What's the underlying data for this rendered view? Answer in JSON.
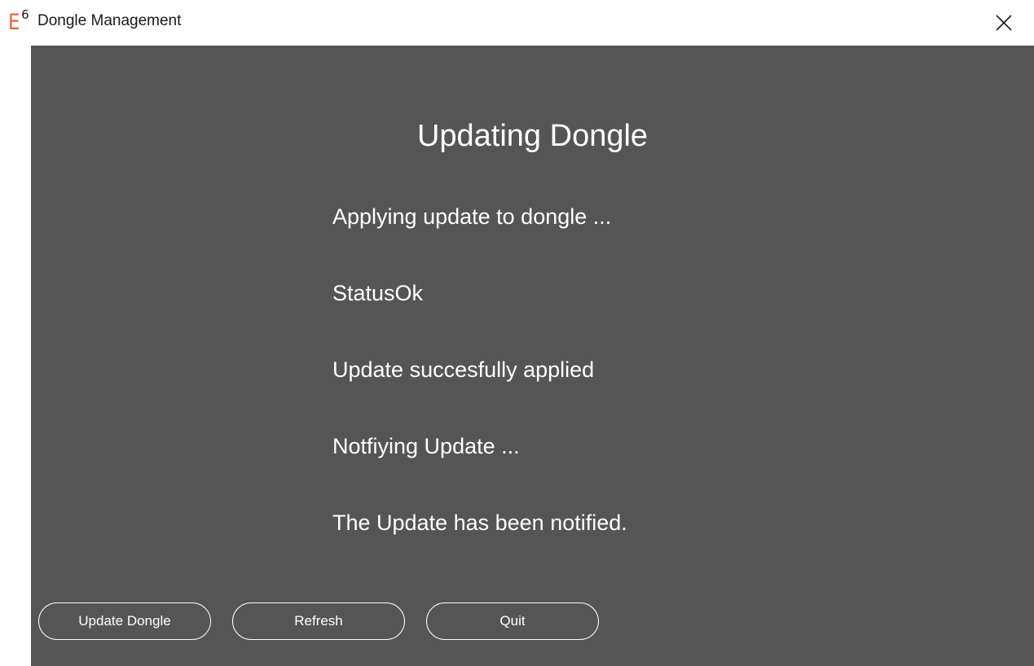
{
  "window": {
    "logo_letter": "E",
    "logo_superscript": "6",
    "title": "Dongle Management",
    "close_icon": "close-icon"
  },
  "main": {
    "heading": "Updating Dongle",
    "messages": [
      "Applying update to dongle ...",
      "StatusOk",
      "Update succesfully applied",
      "Notfiying Update ...",
      "The Update has been notified."
    ]
  },
  "buttons": {
    "update_dongle": "Update Dongle",
    "refresh": "Refresh",
    "quit": "Quit"
  },
  "colors": {
    "content_background": "#555555",
    "logo_accent": "#e8643c",
    "text_on_dark": "#ffffff"
  }
}
